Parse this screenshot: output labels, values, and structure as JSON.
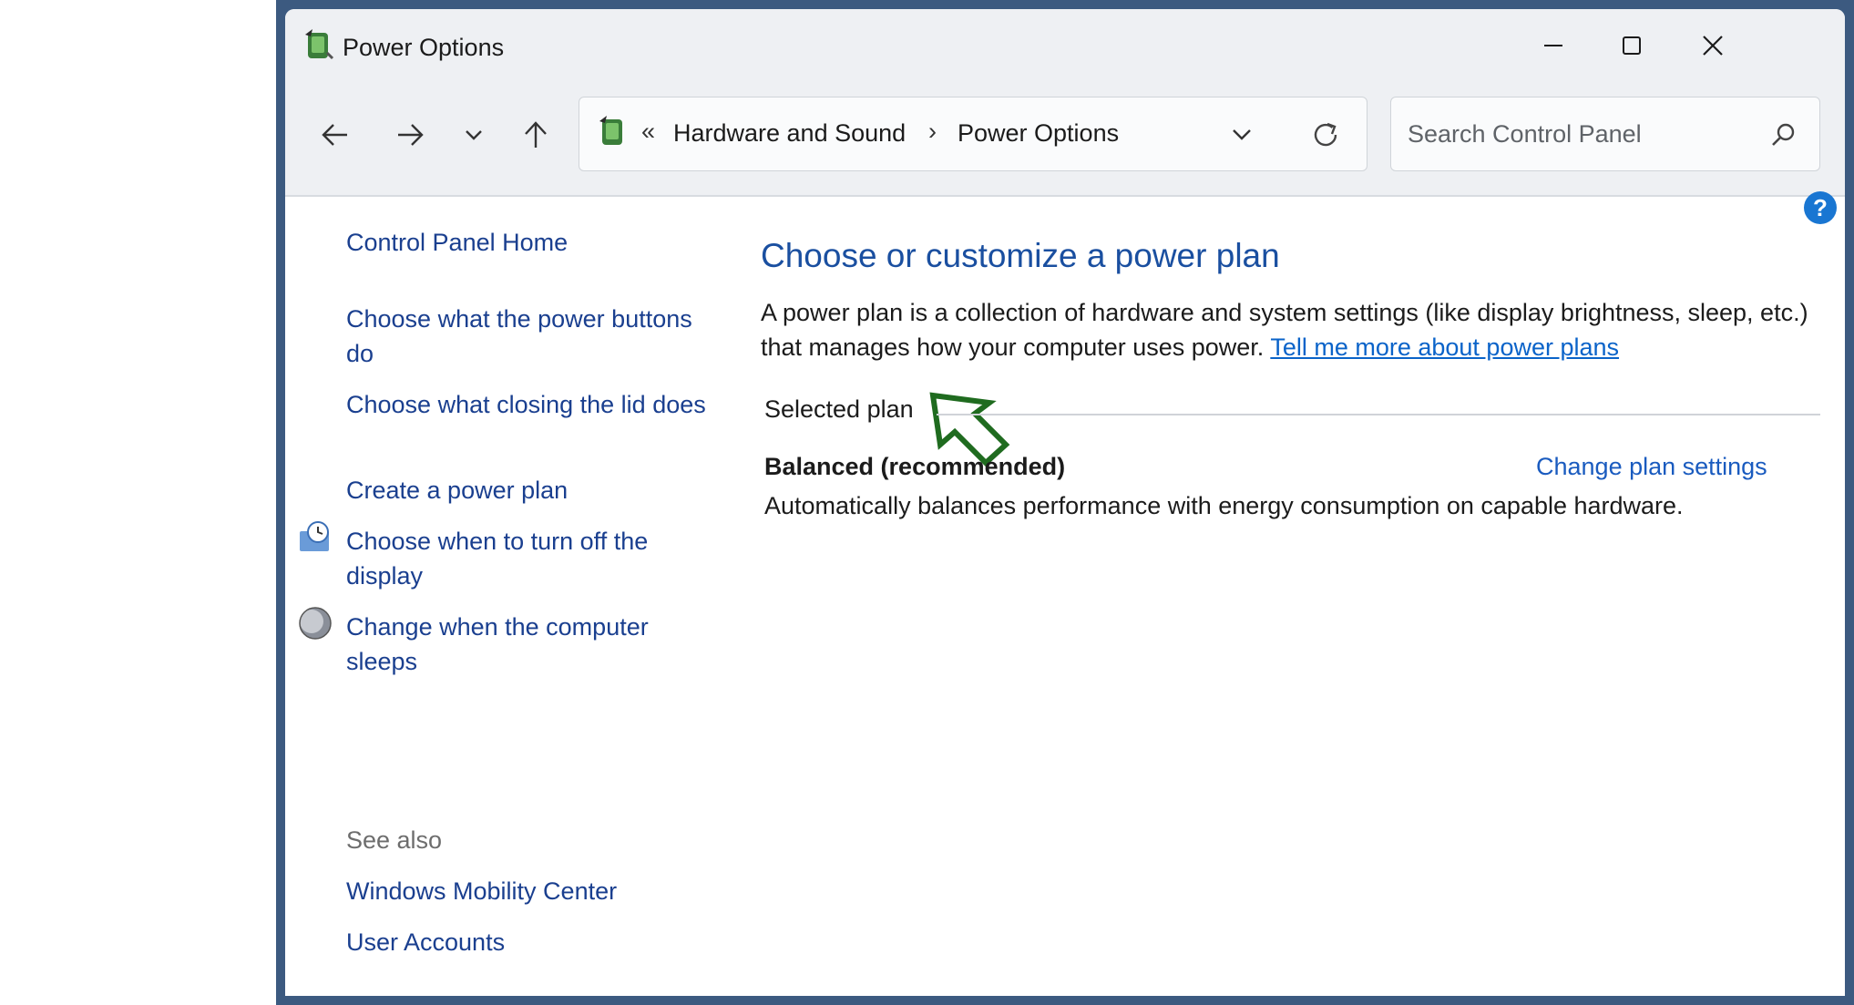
{
  "window": {
    "title": "Power Options"
  },
  "nav": {
    "breadcrumb_overflow": "«",
    "breadcrumbs": [
      "Hardware and Sound",
      "Power Options"
    ],
    "breadcrumb_separator": "›",
    "search_placeholder": "Search Control Panel"
  },
  "sidebar": {
    "home": "Control Panel Home",
    "items": [
      {
        "label": "Choose what the power buttons do",
        "icon": null
      },
      {
        "label": "Choose what closing the lid does",
        "icon": null
      },
      {
        "label": "Create a power plan",
        "icon": null
      },
      {
        "label": "Choose when to turn off the display",
        "icon": "display-clock-icon"
      },
      {
        "label": "Change when the computer sleeps",
        "icon": "moon-sleep-icon"
      }
    ],
    "see_also_heading": "See also",
    "see_also": [
      "Windows Mobility Center",
      "User Accounts"
    ]
  },
  "main": {
    "title": "Choose or customize a power plan",
    "description": "A power plan is a collection of hardware and system settings (like display brightness, sleep, etc.) that manages how your computer uses power.",
    "learn_more_link": "Tell me more about power plans",
    "selected_plan_label": "Selected plan",
    "plan": {
      "name": "Balanced (recommended)",
      "change_link": "Change plan settings",
      "description": "Automatically balances performance with energy consumption on capable hardware."
    }
  },
  "help_label": "?",
  "colors": {
    "frame": "#3c5a80",
    "link": "#1a3f8f",
    "title_blue": "#1a4fa0",
    "pointer": "#1f6b1f"
  }
}
